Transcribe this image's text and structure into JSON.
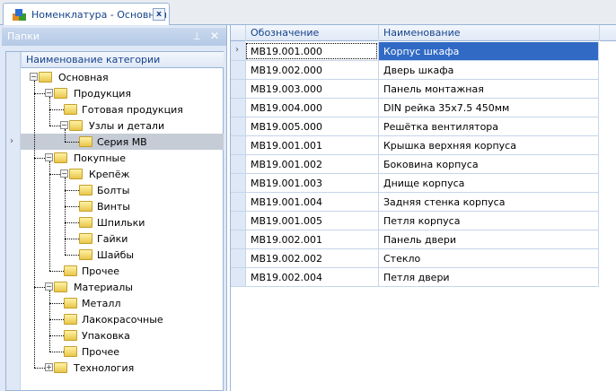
{
  "tab": {
    "title": "Номенклатура - Основная",
    "close": "x"
  },
  "panel": {
    "title": "Папки",
    "pin": "⊥",
    "close": "✕"
  },
  "tree": {
    "header": "Наименование категории",
    "nodes": [
      {
        "label": "Основная",
        "level": 0,
        "expander": "−"
      },
      {
        "label": "Продукция",
        "level": 1,
        "expander": "−"
      },
      {
        "label": "Готовая продукция",
        "level": 2
      },
      {
        "label": "Узлы и детали",
        "level": 2,
        "expander": "−"
      },
      {
        "label": "Серия МВ",
        "level": 3,
        "selected": true
      },
      {
        "label": "Покупные",
        "level": 1,
        "expander": "−"
      },
      {
        "label": "Крепёж",
        "level": 2,
        "expander": "−"
      },
      {
        "label": "Болты",
        "level": 3
      },
      {
        "label": "Винты",
        "level": 3
      },
      {
        "label": "Шпильки",
        "level": 3
      },
      {
        "label": "Гайки",
        "level": 3
      },
      {
        "label": "Шайбы",
        "level": 3
      },
      {
        "label": "Прочее",
        "level": 2
      },
      {
        "label": "Материалы",
        "level": 1,
        "expander": "−"
      },
      {
        "label": "Металл",
        "level": 2
      },
      {
        "label": "Лакокрасочные",
        "level": 2
      },
      {
        "label": "Упаковка",
        "level": 2
      },
      {
        "label": "Прочее",
        "level": 2
      },
      {
        "label": "Технология",
        "level": 1,
        "expander": "+"
      }
    ]
  },
  "grid": {
    "columns": [
      "Обозначение",
      "Наименование"
    ],
    "rows": [
      [
        "МВ19.001.000",
        "Корпус шкафа"
      ],
      [
        "МВ19.002.000",
        "Дверь шкафа"
      ],
      [
        "МВ19.003.000",
        "Панель монтажная"
      ],
      [
        "МВ19.004.000",
        "DIN рейка 35x7.5 450мм"
      ],
      [
        "МВ19.005.000",
        "Решётка вентилятора"
      ],
      [
        "МВ19.001.001",
        "Крышка верхняя корпуса"
      ],
      [
        "МВ19.001.002",
        "Боковина корпуса"
      ],
      [
        "МВ19.001.003",
        "Днище корпуса"
      ],
      [
        "МВ19.001.004",
        "Задняя стенка корпуса"
      ],
      [
        "МВ19.001.005",
        "Петля корпуса"
      ],
      [
        "МВ19.002.001",
        "Панель двери"
      ],
      [
        "МВ19.002.002",
        "Стекло"
      ],
      [
        "МВ19.002.004",
        "Петля двери"
      ]
    ],
    "selected_row": 0
  },
  "colors": {
    "selection": "#316ac5",
    "header_text": "#15428b",
    "panel_bg": "#dfe8f6"
  }
}
